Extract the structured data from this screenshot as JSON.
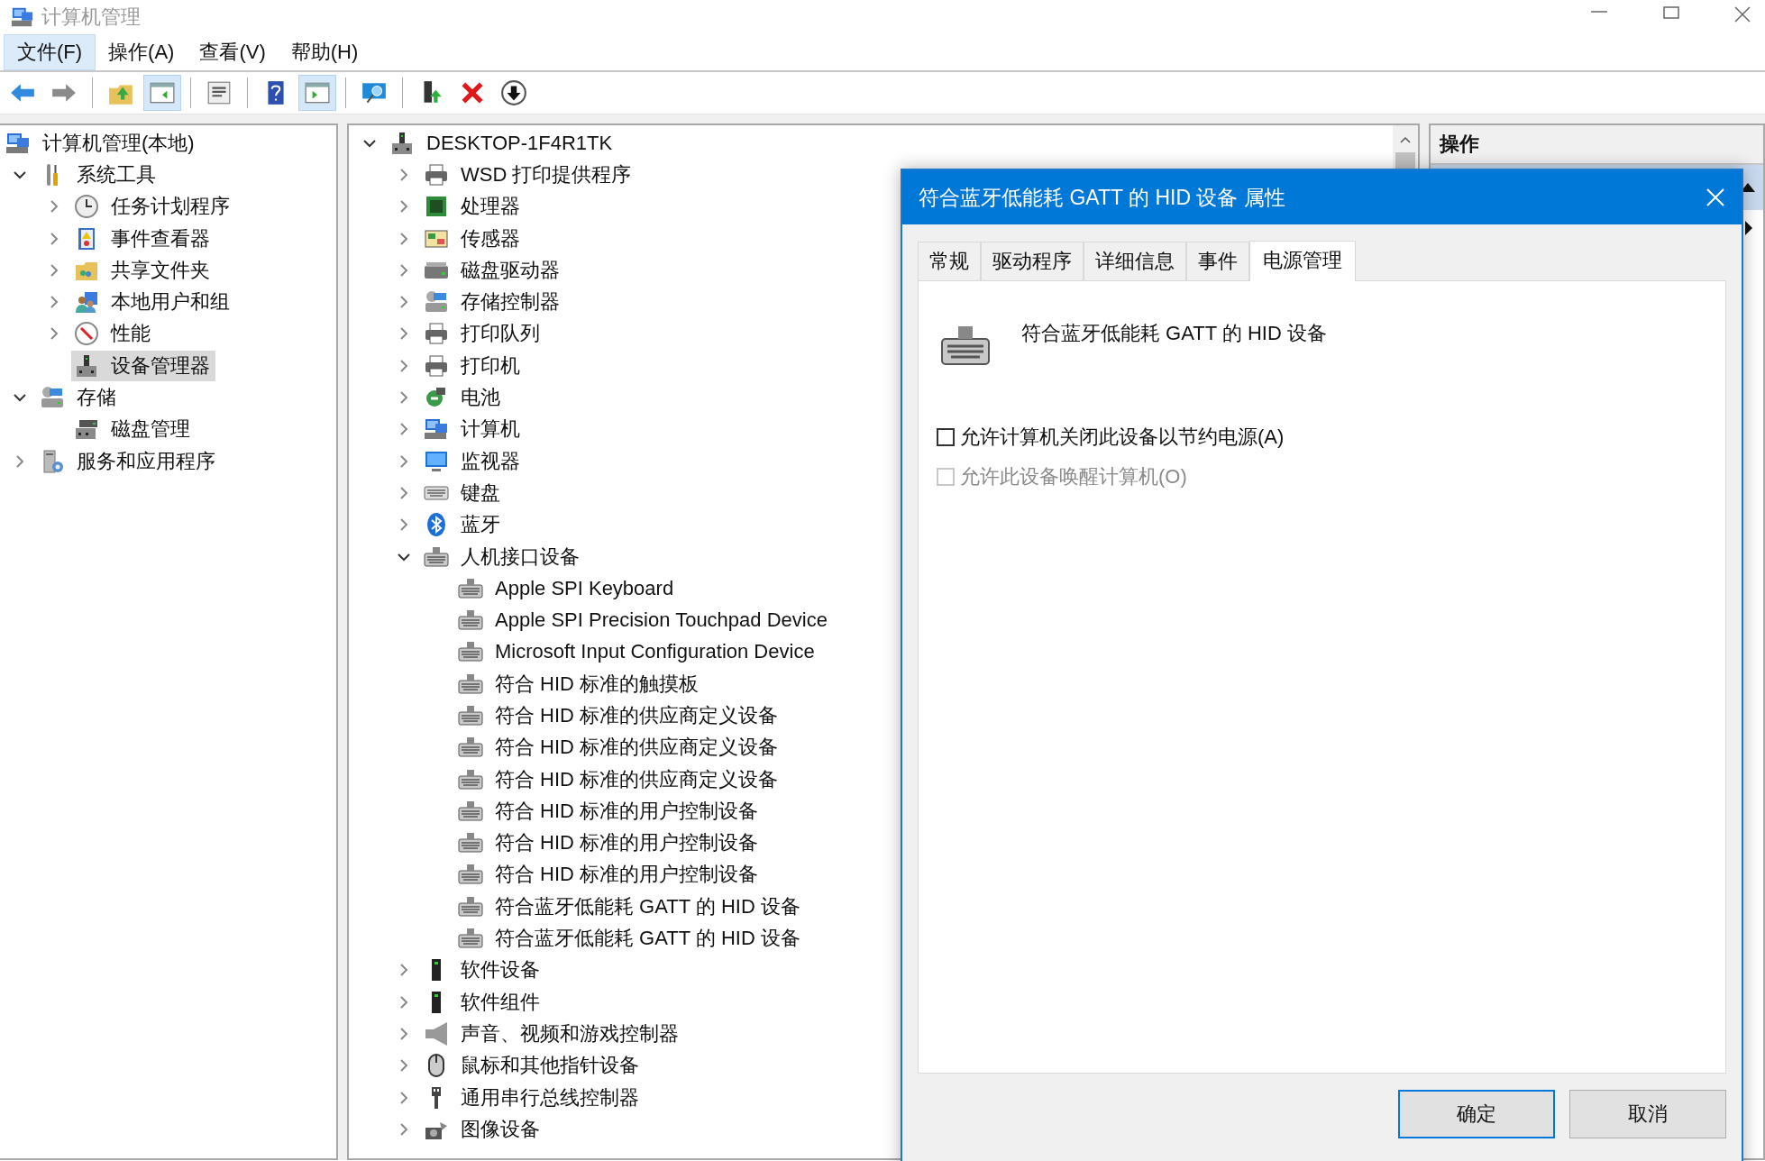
{
  "window": {
    "title": "计算机管理"
  },
  "menu": [
    {
      "label": "文件(F)",
      "selected": true
    },
    {
      "label": "操作(A)",
      "selected": false
    },
    {
      "label": "查看(V)",
      "selected": false
    },
    {
      "label": "帮助(H)",
      "selected": false
    }
  ],
  "toolbar": [
    [
      {
        "pressed": false
      },
      {
        "pressed": false
      }
    ],
    [
      {
        "pressed": false
      },
      {
        "pressed": true
      }
    ],
    [
      {
        "pressed": false
      }
    ],
    [
      {
        "pressed": false
      },
      {
        "pressed": true
      }
    ],
    [
      {
        "pressed": false
      }
    ],
    [
      {
        "pressed": false
      },
      {
        "pressed": false
      },
      {
        "pressed": false
      }
    ]
  ],
  "left_tree": [
    {
      "label": "计算机管理(本地)",
      "selected": false,
      "children": [
        {
          "label": "系统工具",
          "expanded": true,
          "selected": false,
          "children": [
            {
              "label": "任务计划程序",
              "expanded": false,
              "selected": false
            },
            {
              "label": "事件查看器",
              "expanded": false,
              "selected": false
            },
            {
              "label": "共享文件夹",
              "expanded": false,
              "selected": false
            },
            {
              "label": "本地用户和组",
              "expanded": false,
              "selected": false
            },
            {
              "label": "性能",
              "expanded": false,
              "selected": false
            },
            {
              "label": "设备管理器",
              "selected": true
            }
          ]
        },
        {
          "label": "存储",
          "expanded": true,
          "selected": false,
          "children": [
            {
              "label": "磁盘管理",
              "selected": false
            }
          ]
        },
        {
          "label": "服务和应用程序",
          "expanded": false,
          "selected": false
        }
      ]
    }
  ],
  "device_tree": [
    {
      "label": "DESKTOP-1F4R1TK",
      "expanded": true,
      "children": [
        {
          "label": "WSD 打印提供程序",
          "expanded": false
        },
        {
          "label": "处理器",
          "expanded": false
        },
        {
          "label": "传感器",
          "expanded": false
        },
        {
          "label": "磁盘驱动器",
          "expanded": false
        },
        {
          "label": "存储控制器",
          "expanded": false
        },
        {
          "label": "打印队列",
          "expanded": false
        },
        {
          "label": "打印机",
          "expanded": false
        },
        {
          "label": "电池",
          "expanded": false
        },
        {
          "label": "计算机",
          "expanded": false
        },
        {
          "label": "监视器",
          "expanded": false
        },
        {
          "label": "键盘",
          "expanded": false
        },
        {
          "label": "蓝牙",
          "expanded": false
        },
        {
          "label": "人机接口设备",
          "expanded": true,
          "children": [
            {
              "label": "Apple SPI Keyboard"
            },
            {
              "label": "Apple SPI Precision Touchpad Device"
            },
            {
              "label": "Microsoft Input Configuration Device"
            },
            {
              "label": "符合 HID 标准的触摸板"
            },
            {
              "label": "符合 HID 标准的供应商定义设备"
            },
            {
              "label": "符合 HID 标准的供应商定义设备"
            },
            {
              "label": "符合 HID 标准的供应商定义设备"
            },
            {
              "label": "符合 HID 标准的用户控制设备"
            },
            {
              "label": "符合 HID 标准的用户控制设备"
            },
            {
              "label": "符合 HID 标准的用户控制设备"
            },
            {
              "label": "符合蓝牙低能耗 GATT 的 HID 设备"
            },
            {
              "label": "符合蓝牙低能耗 GATT 的 HID 设备"
            }
          ]
        },
        {
          "label": "软件设备",
          "expanded": false
        },
        {
          "label": "软件组件",
          "expanded": false
        },
        {
          "label": "声音、视频和游戏控制器",
          "expanded": false
        },
        {
          "label": "鼠标和其他指针设备",
          "expanded": false
        },
        {
          "label": "通用串行总线控制器",
          "expanded": false
        },
        {
          "label": "图像设备",
          "expanded": false
        }
      ]
    }
  ],
  "actions_pane": {
    "header": "操作"
  },
  "dialog": {
    "title": "符合蓝牙低能耗 GATT 的 HID 设备 属性",
    "tabs": [
      {
        "label": "常规",
        "selected": false
      },
      {
        "label": "驱动程序",
        "selected": false
      },
      {
        "label": "详细信息",
        "selected": false
      },
      {
        "label": "事件",
        "selected": false
      },
      {
        "label": "电源管理",
        "selected": true
      }
    ],
    "device_name": "符合蓝牙低能耗 GATT 的 HID 设备",
    "options": [
      {
        "label": "允许计算机关闭此设备以节约电源(A)",
        "checked": false,
        "disabled": false
      },
      {
        "label": "允许此设备唤醒计算机(O)",
        "checked": false,
        "disabled": true
      }
    ],
    "buttons": [
      {
        "label": "确定",
        "default": true
      },
      {
        "label": "取消",
        "default": false
      }
    ]
  }
}
